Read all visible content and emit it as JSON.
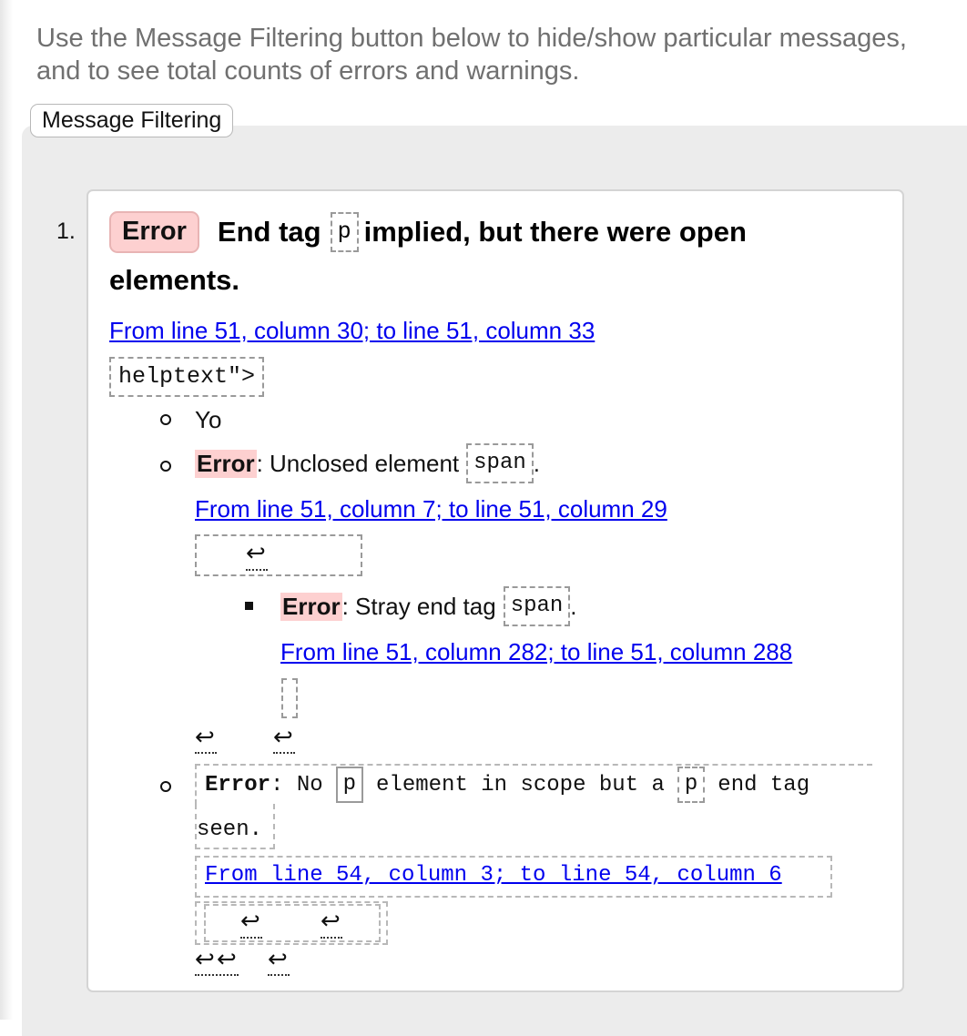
{
  "intro": "Use the Message Filtering button below to hide/show particular messages, and to see total counts of errors and warnings.",
  "filter_button": "Message Filtering",
  "messages": [
    {
      "number": "1.",
      "type": "Error",
      "title_before": "End tag",
      "title_code": "p",
      "title_after_line1": "implied, but there were open",
      "title_after_line2": "elements.",
      "location": "From line 51, column 30; to line 51, column 33",
      "extract": "helptext\">",
      "sub": [
        {
          "text": "Yo"
        },
        {
          "type": "Error",
          "text": ": Unclosed element",
          "code": "span",
          "after": ".",
          "location": "From line 51, column 7; to line 51, column 29",
          "nested": {
            "type": "Error",
            "text": ": Stray end tag",
            "code": "span",
            "after": ".",
            "location": "From line 51, column 282; to line 51, column 288"
          }
        },
        {
          "type": "Error",
          "text_a": ": No",
          "code_a": "p",
          "text_b": "element in scope but a",
          "code_b": "p",
          "text_c": "end tag",
          "text_d": "seen.",
          "location": "From line 54, column 3; to line 54, column 6"
        }
      ]
    }
  ],
  "return_glyph": "↩",
  "colors": {
    "error_bg": "#fdd0d0",
    "link": "#0000ee",
    "panel": "#ececec"
  }
}
